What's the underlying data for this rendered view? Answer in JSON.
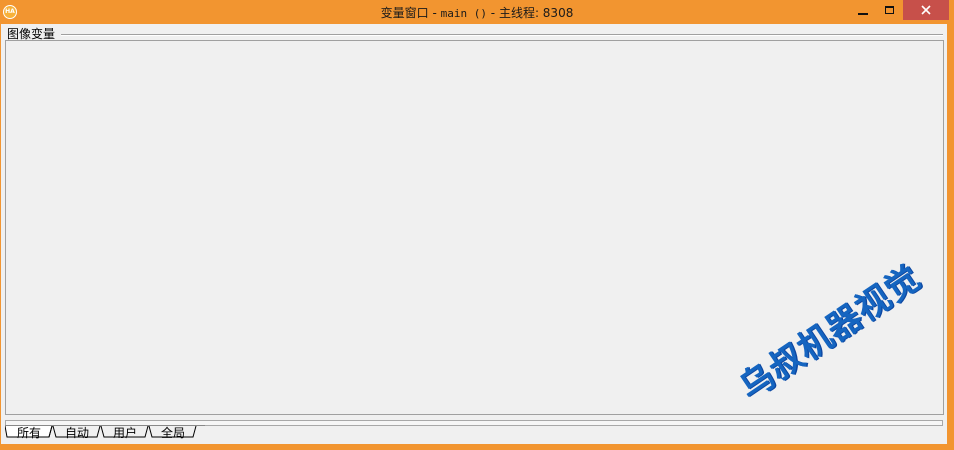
{
  "window": {
    "title_prefix": "变量窗口 - ",
    "title_func": "main ()",
    "title_suffix": " - 主线程: 8308",
    "app_icon_text": "HA"
  },
  "group": {
    "label": "图像变量"
  },
  "tabs": [
    {
      "label": "所有",
      "active": true
    },
    {
      "label": "自动",
      "active": false
    },
    {
      "label": "用户",
      "active": false
    },
    {
      "label": "全局",
      "active": false
    }
  ],
  "watermark": "乌叔机器视觉",
  "colors": {
    "titlebar": "#f29530",
    "close_button": "#c7504a",
    "client_bg": "#f0f0f0",
    "watermark": "#1565c0"
  }
}
